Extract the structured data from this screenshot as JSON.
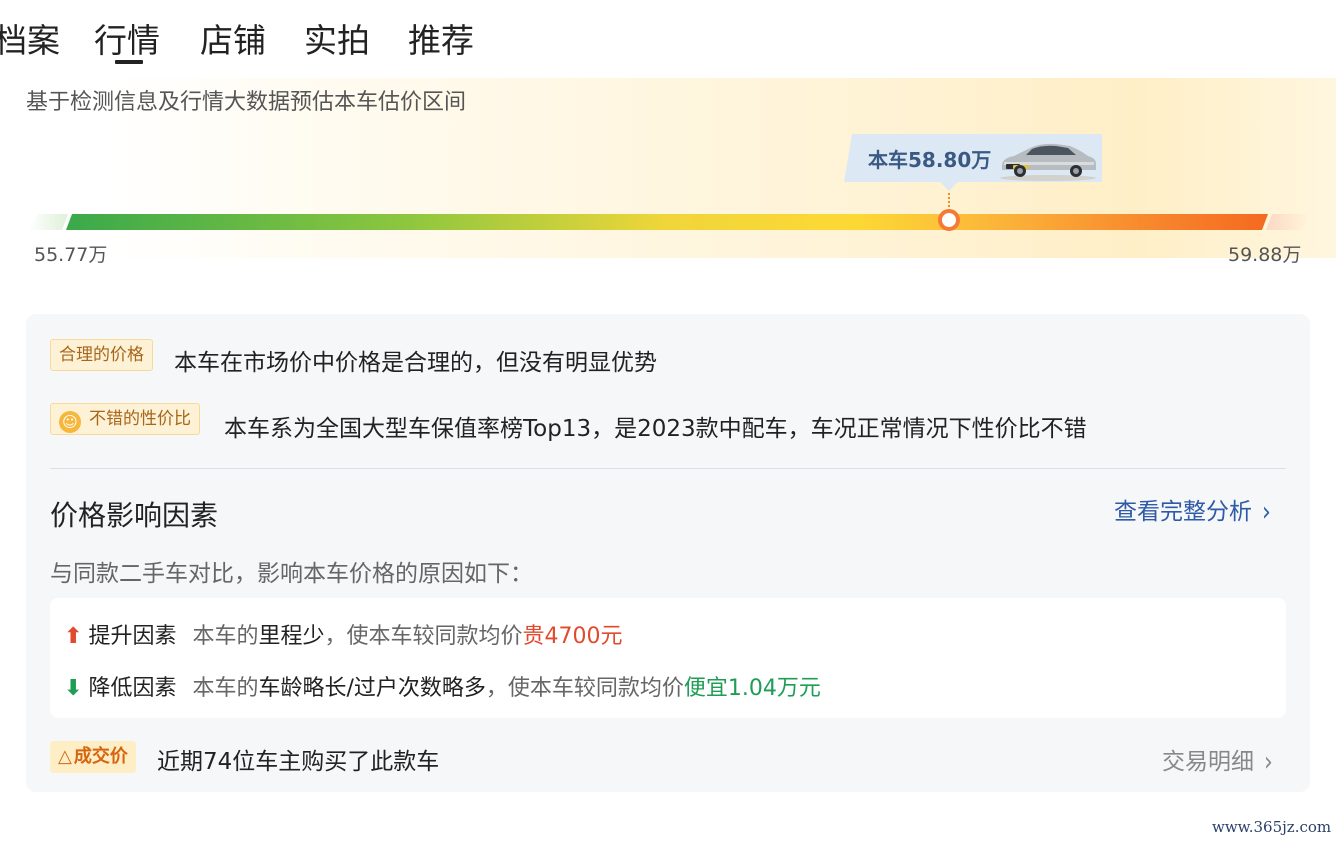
{
  "tabs": [
    {
      "label": "档案"
    },
    {
      "label": "行情",
      "active": true
    },
    {
      "label": "店铺"
    },
    {
      "label": "实拍"
    },
    {
      "label": "推荐"
    }
  ],
  "estimate": {
    "subtitle": "基于检测信息及行情大数据预估本车估价区间",
    "current_price_label": "本车58.80万",
    "current_price_value": 58.8,
    "range_min": "55.77万",
    "range_max": "59.88万",
    "range_min_value": 55.77,
    "range_max_value": 59.88,
    "car_icon": "car-image"
  },
  "assessment": {
    "reasonable_tag": "合理的价格",
    "reasonable_text": "本车在市场价中价格是合理的，但没有明显优势",
    "value_tag": "不错的性价比",
    "value_tag_icon": "smile-icon",
    "value_text": "本车系为全国大型车保值率榜Top13，是2023款中配车，车况正常情况下性价比不错"
  },
  "factors": {
    "title": "价格影响因素",
    "full_analysis_link": "查看完整分析",
    "intro": "与同款二手车对比，影响本车价格的原因如下：",
    "up": {
      "icon": "arrow-up-icon",
      "label": "提升因素",
      "desc_prefix": "本车的",
      "desc_item": "里程少",
      "desc_mid": "，使本车较同款均价",
      "desc_delta": "贵4700元"
    },
    "down": {
      "icon": "arrow-down-icon",
      "label": "降低因素",
      "desc_prefix": "本车的",
      "desc_item": "车龄略长/过户次数略多",
      "desc_mid": "，使本车较同款均价",
      "desc_delta": "便宜1.04万元"
    }
  },
  "deals": {
    "tag": "成交价",
    "text": "近期74位车主购买了此款车",
    "link": "交易明细"
  },
  "colors": {
    "link_blue": "#2f5aa8",
    "price_up_red": "#e24a2e",
    "price_down_green": "#1f9d55",
    "marker_orange": "#f47a35",
    "tag_gold": "#a8661a"
  },
  "watermark": "www.365jz.com"
}
